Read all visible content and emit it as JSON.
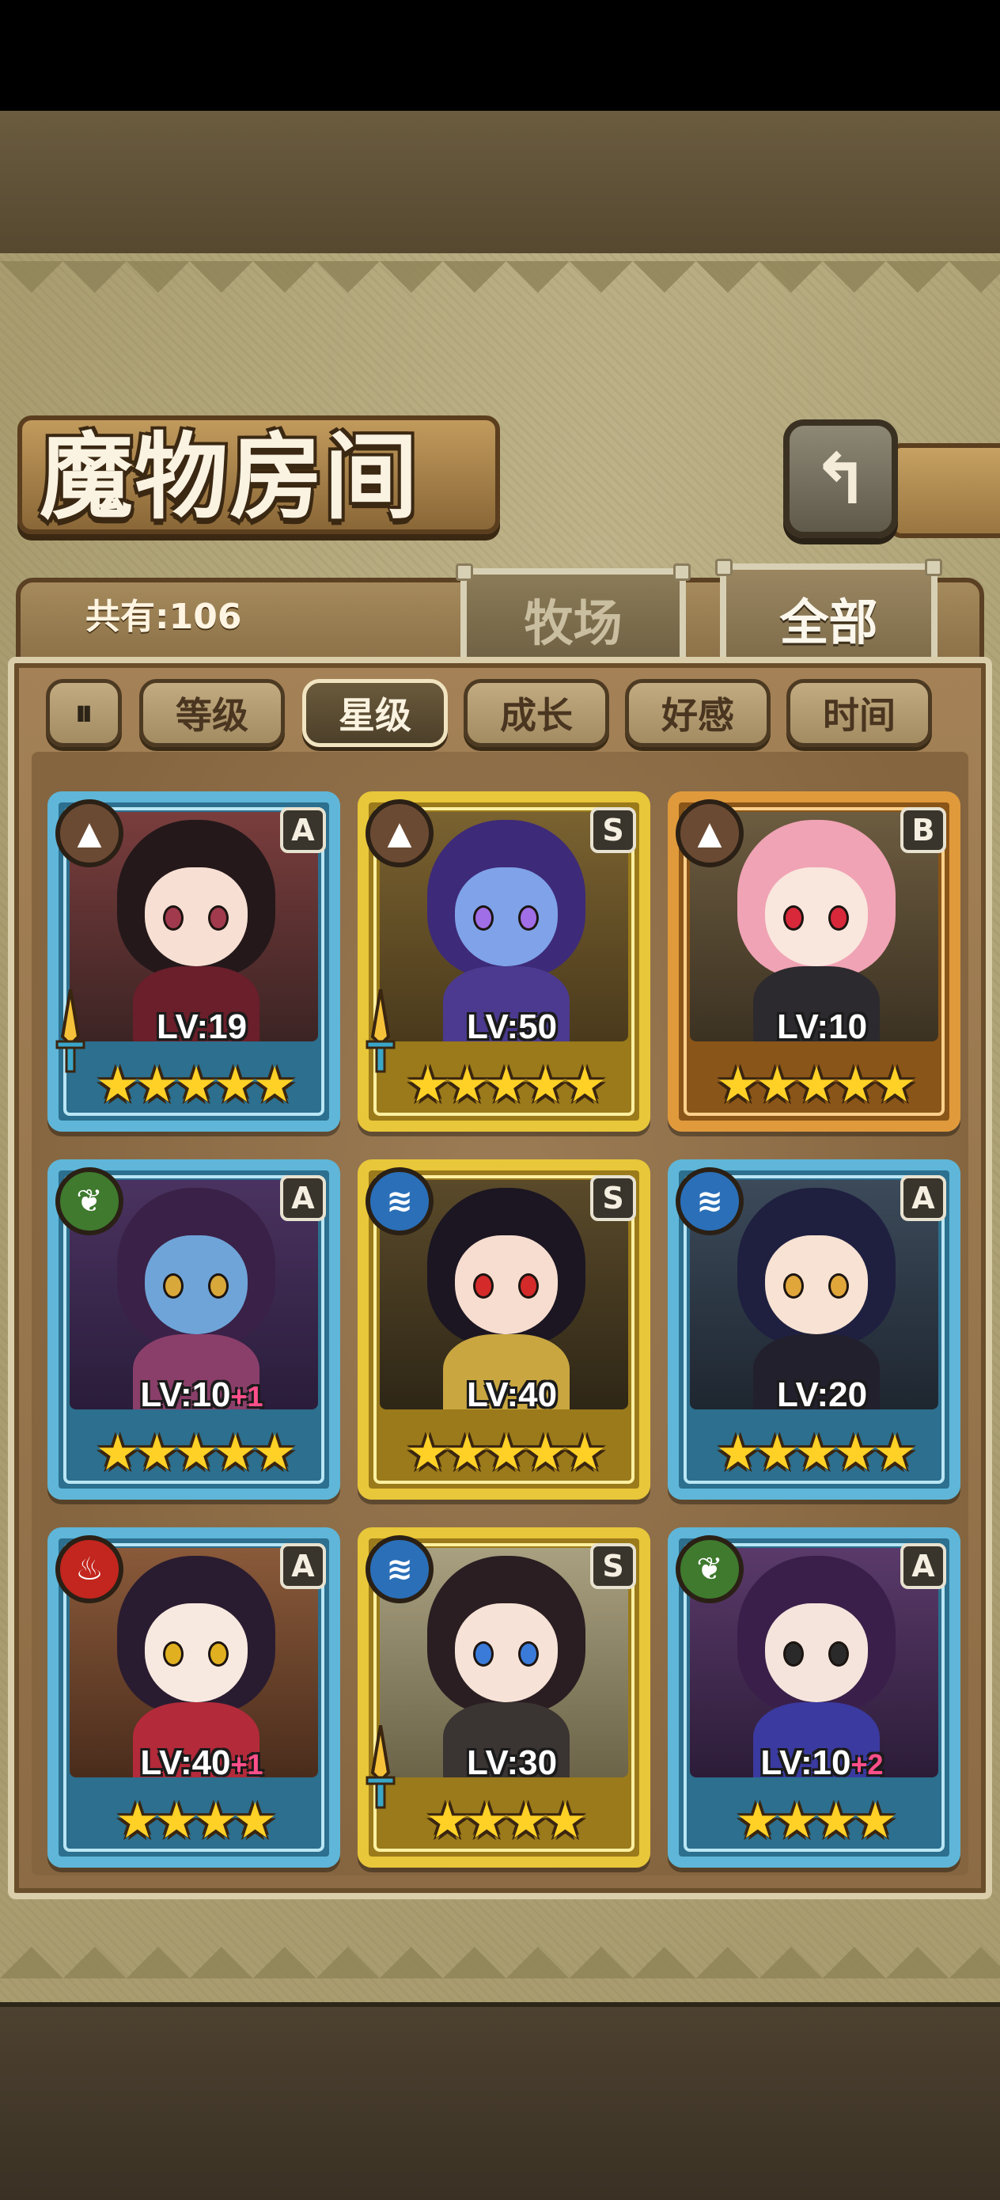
{
  "header": {
    "title": "魔物房间",
    "back_icon": "↰"
  },
  "inventory": {
    "count_label": "共有:106"
  },
  "tabs": [
    {
      "label": "牧场",
      "active": false
    },
    {
      "label": "全部",
      "active": true
    }
  ],
  "sort": {
    "order_icon": "⏸",
    "options": [
      {
        "label": "等级",
        "active": false
      },
      {
        "label": "星级",
        "active": true
      },
      {
        "label": "成长",
        "active": false
      },
      {
        "label": "好感",
        "active": false
      },
      {
        "label": "时间",
        "active": false
      }
    ]
  },
  "colors": {
    "frame_blue": "#5fb6d8",
    "frame_gold": "#e8c73a",
    "frame_orange": "#e09a3c",
    "elem_earth": "#6b4a33",
    "elem_wood": "#3f7a2e",
    "elem_water": "#2a6fb8",
    "elem_fire": "#c2261e"
  },
  "monsters": [
    {
      "element": "mountain-icon",
      "rank": "A",
      "level": "LV:19",
      "plus": "",
      "stars": "★★★★★",
      "frame": "blue",
      "weapon": true
    },
    {
      "element": "mountain-icon",
      "rank": "S",
      "level": "LV:50",
      "plus": "",
      "stars": "★★★★★",
      "frame": "gold",
      "weapon": true
    },
    {
      "element": "mountain-icon",
      "rank": "B",
      "level": "LV:10",
      "plus": "",
      "stars": "★★★★★",
      "frame": "orange",
      "weapon": false
    },
    {
      "element": "leaf-icon",
      "rank": "A",
      "level": "LV:10",
      "plus": "+1",
      "stars": "★★★★★",
      "frame": "blue",
      "weapon": false
    },
    {
      "element": "water-icon",
      "rank": "S",
      "level": "LV:40",
      "plus": "",
      "stars": "★★★★★",
      "frame": "gold",
      "weapon": false
    },
    {
      "element": "water-icon",
      "rank": "A",
      "level": "LV:20",
      "plus": "",
      "stars": "★★★★★",
      "frame": "blue",
      "weapon": false
    },
    {
      "element": "fire-icon",
      "rank": "A",
      "level": "LV:40",
      "plus": "+1",
      "stars": "★★★★",
      "frame": "blue",
      "weapon": false
    },
    {
      "element": "water-icon",
      "rank": "S",
      "level": "LV:30",
      "plus": "",
      "stars": "★★★★",
      "frame": "gold",
      "weapon": true
    },
    {
      "element": "leaf-icon",
      "rank": "A",
      "level": "LV:10",
      "plus": "+2",
      "stars": "★★★★",
      "frame": "blue",
      "weapon": false
    }
  ]
}
